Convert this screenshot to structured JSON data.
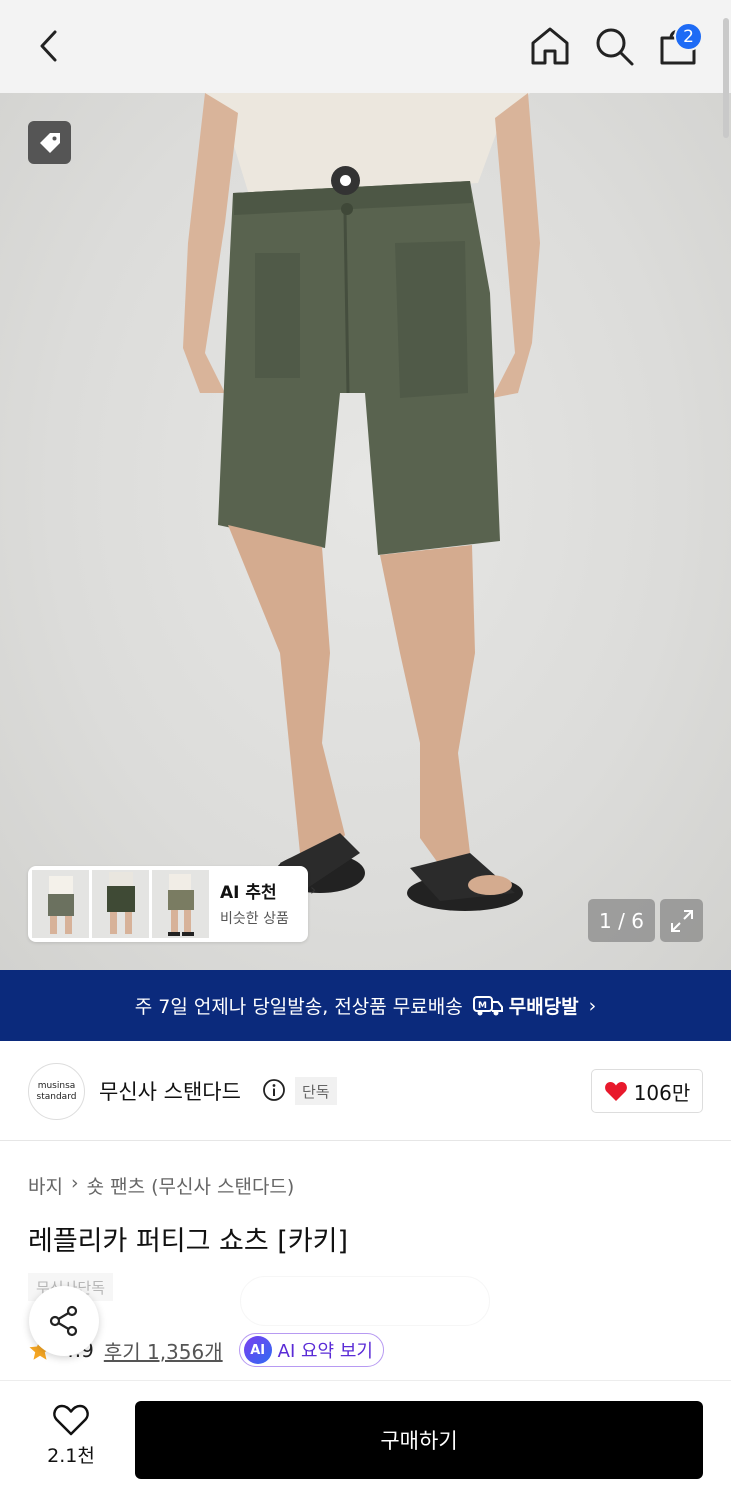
{
  "header": {
    "cart_count": "2",
    "icons": [
      "back-icon",
      "home-icon",
      "search-icon",
      "cart-icon"
    ]
  },
  "gallery": {
    "counter": "1 / 6",
    "ai_recommend": {
      "title": "AI 추천",
      "subtitle": "비슷한 상품"
    }
  },
  "banner": {
    "text": "주 7일 언제나 당일발송, 전상품 무료배송",
    "badge_label": "무배당발"
  },
  "brand": {
    "logo_line1": "musinsa",
    "logo_line2": "standard",
    "name": "무신사 스탠다드",
    "exclusive_badge": "단독",
    "likes": "106만"
  },
  "product": {
    "breadcrumb": [
      "바지",
      "숏 팬츠 (무신사 스탠다드)"
    ],
    "title": "레플리카 퍼티그 쇼츠 [카키]",
    "exclusive_tag": "무신사단독",
    "rating": "4.9",
    "reviews": "후기 1,356개",
    "ai_summary": "AI 요약 보기"
  },
  "bottom": {
    "wish_count": "2.1천",
    "buy_label": "구매하기"
  },
  "colors": {
    "banner_bg": "#0b2a7c",
    "badge_blue": "#1e6bf5",
    "star": "#f5a623",
    "heart": "#e8192c",
    "ai_purple": "#5a2bd6"
  }
}
